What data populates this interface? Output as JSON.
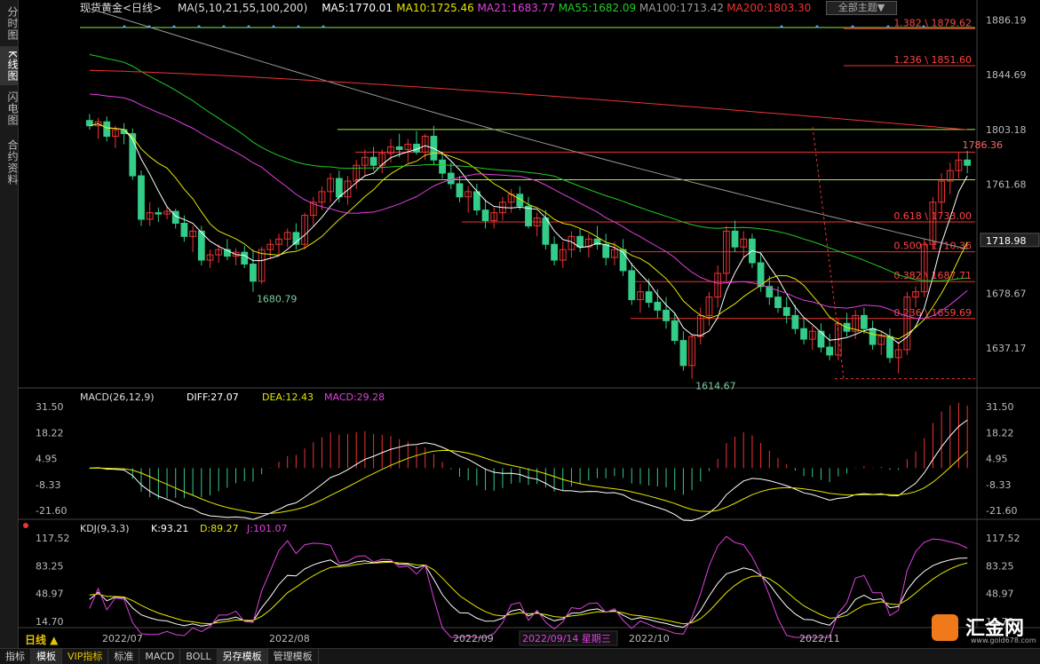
{
  "sidebar": {
    "tabs": [
      {
        "label": "分时图",
        "active": false
      },
      {
        "label": "K线图",
        "active": true
      },
      {
        "label": "闪电图",
        "active": false
      },
      {
        "label": "合约资料",
        "active": false
      }
    ]
  },
  "header": {
    "symbol": "现货黄金<日线>",
    "ma": [
      {
        "text": "MA(5,10,21,55,100,200)",
        "color": "#dddddd"
      },
      {
        "text": "MA5:1770.01",
        "color": "#ffffff"
      },
      {
        "text": "MA10:1725.46",
        "color": "#e6e600"
      },
      {
        "text": "MA21:1683.77",
        "color": "#e040e0"
      },
      {
        "text": "MA55:1682.09",
        "color": "#22cc22"
      },
      {
        "text": "MA100:1713.42",
        "color": "#999999"
      },
      {
        "text": "MA200:1803.30",
        "color": "#ee3333"
      }
    ],
    "theme_button": "全部主题▼"
  },
  "price_axis": [
    "1886.19",
    "1844.69",
    "1803.18",
    "1761.68",
    "1720.18",
    "1678.67",
    "1637.17"
  ],
  "price_tag": "1718.98",
  "annotations": {
    "low1": "1680.79",
    "low2": "1614.67",
    "high": "1786.36"
  },
  "fib_levels": [
    {
      "label": "1.382 \\ 1879.62",
      "price": 1879.62
    },
    {
      "label": "1.236 \\ 1851.60",
      "price": 1851.6
    },
    {
      "label": "0.618 \\ 1733.00",
      "price": 1733.0
    },
    {
      "label": "0.500 \\ 1710.36",
      "price": 1710.36
    },
    {
      "label": "0.382 \\ 1687.71",
      "price": 1687.71
    },
    {
      "label": "0.236 \\ 1659.69",
      "price": 1659.69
    }
  ],
  "macd": {
    "title": "MACD(26,12,9)",
    "diff": "DIFF:27.07",
    "dea": "DEA:12.43",
    "macd": "MACD:29.28",
    "axis": [
      "31.50",
      "18.22",
      "4.95",
      "-8.33",
      "-21.60"
    ]
  },
  "kdj": {
    "title": "KDJ(9,3,3)",
    "k": "K:93.21",
    "d": "D:89.27",
    "j": "J:101.07",
    "axis": [
      "117.52",
      "83.25",
      "48.97",
      "14.70"
    ]
  },
  "time_axis": {
    "labels": [
      "2022/07",
      "2022/08",
      "2022/09",
      "2022/10",
      "2022/11"
    ],
    "cursor": "2022/09/14 星期三"
  },
  "period_label": "日线 ▲",
  "bottom_tabs": [
    {
      "label": "指标",
      "active": false
    },
    {
      "label": "模板",
      "active": true
    },
    {
      "label": "VIP指标",
      "active": false
    },
    {
      "label": "标准",
      "active": false
    },
    {
      "label": "MACD",
      "active": false
    },
    {
      "label": "BOLL",
      "active": false
    },
    {
      "label": "另存模板",
      "active": true
    },
    {
      "label": "管理模板",
      "active": false
    }
  ],
  "logo": {
    "name": "汇金网",
    "url": "www.gold678.com"
  },
  "colors": {
    "up": "#ee3333",
    "down": "#33cc88",
    "ma5": "#ffffff",
    "ma10": "#e6e600",
    "ma21": "#e040e0",
    "ma55": "#22cc22",
    "ma100": "#999999",
    "ma200": "#ee3333",
    "fib": "#ee3333",
    "grid": "#333333"
  },
  "chart_data": {
    "type": "candlestick",
    "title": "现货黄金<日线>",
    "price_range": [
      1607,
      1890
    ],
    "candles": [
      [
        1810,
        1815,
        1803,
        1806
      ],
      [
        1806,
        1812,
        1796,
        1809
      ],
      [
        1809,
        1813,
        1794,
        1798
      ],
      [
        1798,
        1806,
        1789,
        1803
      ],
      [
        1803,
        1808,
        1792,
        1800
      ],
      [
        1800,
        1804,
        1765,
        1768
      ],
      [
        1768,
        1772,
        1730,
        1735
      ],
      [
        1735,
        1748,
        1730,
        1740
      ],
      [
        1740,
        1744,
        1733,
        1739
      ],
      [
        1739,
        1745,
        1735,
        1741
      ],
      [
        1741,
        1743,
        1728,
        1732
      ],
      [
        1732,
        1738,
        1718,
        1722
      ],
      [
        1722,
        1730,
        1710,
        1726
      ],
      [
        1726,
        1730,
        1700,
        1704
      ],
      [
        1704,
        1712,
        1698,
        1708
      ],
      [
        1708,
        1716,
        1702,
        1712
      ],
      [
        1712,
        1720,
        1704,
        1707
      ],
      [
        1707,
        1713,
        1700,
        1710
      ],
      [
        1710,
        1715,
        1698,
        1701
      ],
      [
        1701,
        1712,
        1680,
        1688
      ],
      [
        1688,
        1714,
        1686,
        1712
      ],
      [
        1712,
        1720,
        1705,
        1716
      ],
      [
        1716,
        1724,
        1708,
        1720
      ],
      [
        1720,
        1728,
        1714,
        1725
      ],
      [
        1725,
        1732,
        1712,
        1716
      ],
      [
        1716,
        1740,
        1712,
        1738
      ],
      [
        1738,
        1752,
        1730,
        1748
      ],
      [
        1748,
        1760,
        1742,
        1756
      ],
      [
        1756,
        1770,
        1748,
        1766
      ],
      [
        1766,
        1772,
        1748,
        1752
      ],
      [
        1752,
        1768,
        1746,
        1764
      ],
      [
        1764,
        1780,
        1758,
        1776
      ],
      [
        1776,
        1788,
        1768,
        1782
      ],
      [
        1782,
        1790,
        1772,
        1776
      ],
      [
        1776,
        1788,
        1770,
        1785
      ],
      [
        1785,
        1796,
        1778,
        1790
      ],
      [
        1790,
        1800,
        1782,
        1788
      ],
      [
        1788,
        1796,
        1778,
        1792
      ],
      [
        1792,
        1802,
        1784,
        1786
      ],
      [
        1786,
        1800,
        1780,
        1798
      ],
      [
        1798,
        1806,
        1776,
        1780
      ],
      [
        1780,
        1786,
        1766,
        1770
      ],
      [
        1770,
        1778,
        1758,
        1762
      ],
      [
        1762,
        1768,
        1748,
        1752
      ],
      [
        1752,
        1760,
        1740,
        1756
      ],
      [
        1756,
        1762,
        1738,
        1742
      ],
      [
        1742,
        1750,
        1728,
        1734
      ],
      [
        1734,
        1744,
        1728,
        1740
      ],
      [
        1740,
        1752,
        1734,
        1748
      ],
      [
        1748,
        1758,
        1740,
        1754
      ],
      [
        1754,
        1760,
        1742,
        1745
      ],
      [
        1745,
        1752,
        1728,
        1730
      ],
      [
        1730,
        1740,
        1722,
        1736
      ],
      [
        1736,
        1742,
        1712,
        1716
      ],
      [
        1716,
        1722,
        1700,
        1704
      ],
      [
        1704,
        1718,
        1698,
        1712
      ],
      [
        1712,
        1726,
        1706,
        1722
      ],
      [
        1722,
        1728,
        1710,
        1714
      ],
      [
        1714,
        1724,
        1706,
        1720
      ],
      [
        1720,
        1730,
        1712,
        1716
      ],
      [
        1716,
        1724,
        1700,
        1706
      ],
      [
        1706,
        1718,
        1700,
        1712
      ],
      [
        1712,
        1720,
        1692,
        1696
      ],
      [
        1696,
        1702,
        1670,
        1674
      ],
      [
        1674,
        1686,
        1664,
        1680
      ],
      [
        1680,
        1690,
        1668,
        1672
      ],
      [
        1672,
        1682,
        1660,
        1666
      ],
      [
        1666,
        1676,
        1652,
        1658
      ],
      [
        1658,
        1664,
        1640,
        1643
      ],
      [
        1643,
        1650,
        1620,
        1624
      ],
      [
        1624,
        1648,
        1614,
        1646
      ],
      [
        1646,
        1668,
        1640,
        1662
      ],
      [
        1662,
        1680,
        1654,
        1676
      ],
      [
        1676,
        1700,
        1668,
        1694
      ],
      [
        1694,
        1730,
        1688,
        1726
      ],
      [
        1726,
        1734,
        1710,
        1714
      ],
      [
        1714,
        1726,
        1706,
        1720
      ],
      [
        1720,
        1724,
        1698,
        1702
      ],
      [
        1702,
        1710,
        1680,
        1684
      ],
      [
        1684,
        1692,
        1670,
        1676
      ],
      [
        1676,
        1684,
        1664,
        1668
      ],
      [
        1668,
        1676,
        1656,
        1662
      ],
      [
        1662,
        1670,
        1648,
        1652
      ],
      [
        1652,
        1660,
        1640,
        1644
      ],
      [
        1644,
        1654,
        1636,
        1650
      ],
      [
        1650,
        1656,
        1634,
        1638
      ],
      [
        1638,
        1648,
        1628,
        1632
      ],
      [
        1632,
        1660,
        1628,
        1656
      ],
      [
        1656,
        1664,
        1646,
        1650
      ],
      [
        1650,
        1666,
        1644,
        1662
      ],
      [
        1662,
        1668,
        1648,
        1652
      ],
      [
        1652,
        1658,
        1636,
        1640
      ],
      [
        1640,
        1650,
        1632,
        1646
      ],
      [
        1646,
        1652,
        1626,
        1630
      ],
      [
        1630,
        1642,
        1618,
        1636
      ],
      [
        1636,
        1680,
        1632,
        1676
      ],
      [
        1676,
        1684,
        1668,
        1680
      ],
      [
        1680,
        1720,
        1676,
        1716
      ],
      [
        1716,
        1752,
        1712,
        1748
      ],
      [
        1748,
        1770,
        1740,
        1764
      ],
      [
        1764,
        1778,
        1754,
        1772
      ],
      [
        1772,
        1786,
        1766,
        1780
      ],
      [
        1780,
        1787,
        1770,
        1776
      ]
    ]
  }
}
